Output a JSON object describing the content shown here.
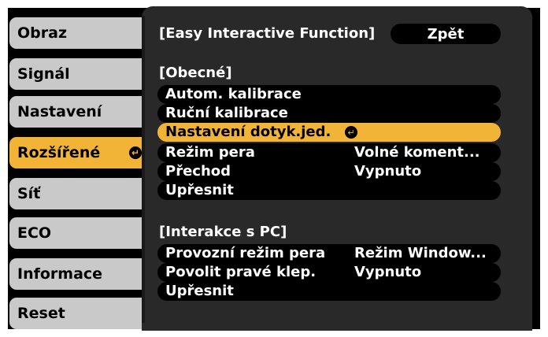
{
  "menu": {
    "items": [
      {
        "label": "Obraz"
      },
      {
        "label": "Signál"
      },
      {
        "label": "Nastavení"
      },
      {
        "label": "Rozšířené"
      },
      {
        "label": "Síť"
      },
      {
        "label": "ECO"
      },
      {
        "label": "Informace"
      },
      {
        "label": "Reset"
      }
    ],
    "active_index": 3
  },
  "header": {
    "title": "[Easy Interactive Function]",
    "back_label": "Zpět"
  },
  "general": {
    "heading": "[Obecné]",
    "rows": [
      {
        "label": "Autom. kalibrace",
        "value": ""
      },
      {
        "label": "Ruční kalibrace",
        "value": ""
      },
      {
        "label": "Nastavení dotyk.jed.",
        "value": ""
      },
      {
        "label": "Režim pera",
        "value": "Volné koment..."
      },
      {
        "label": "Přechod",
        "value": "Vypnuto"
      },
      {
        "label": "Upřesnit",
        "value": ""
      }
    ],
    "selected_index": 2
  },
  "pc": {
    "heading": "[Interakce s PC]",
    "rows": [
      {
        "label": "Provozní režim pera",
        "value": "Režim Window..."
      },
      {
        "label": "Povolit pravé klep.",
        "value": "Vypnuto"
      },
      {
        "label": "Upřesnit",
        "value": ""
      }
    ]
  },
  "colors": {
    "highlight": "#f2b437",
    "menu_item": "#c9c9c9",
    "panel": "#292929"
  },
  "icons": {
    "enter": "enter-icon"
  }
}
